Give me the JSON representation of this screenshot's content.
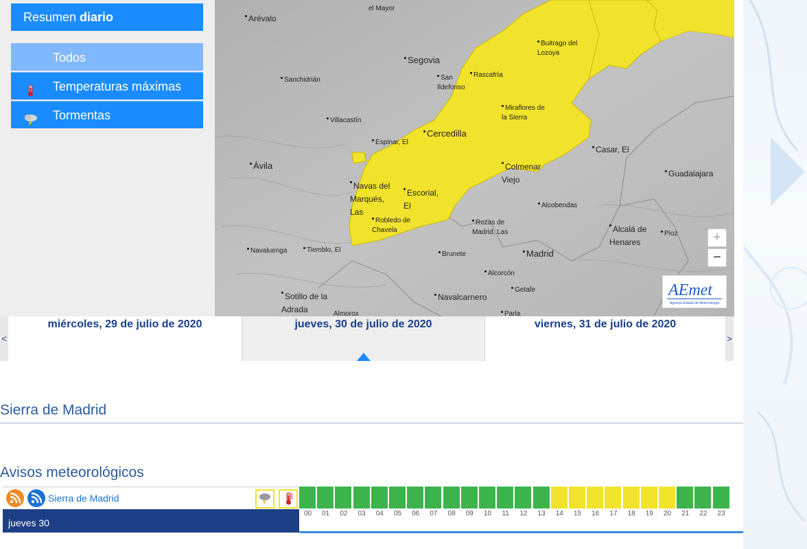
{
  "sidebar": {
    "summary_prefix": "Resumen ",
    "summary_bold": "diario",
    "items": [
      {
        "label": "Todos",
        "icon": "none",
        "active": true
      },
      {
        "label": "Temperaturas máximas",
        "icon": "thermometer-icon",
        "active": false
      },
      {
        "label": "Tormentas",
        "icon": "storm-cloud-icon",
        "active": false
      }
    ]
  },
  "map": {
    "towns": [
      {
        "name": "Arévalo"
      },
      {
        "name": "el Mayor"
      },
      {
        "name": "Segovia"
      },
      {
        "name": "Sanchidrián"
      },
      {
        "name": "San Ildefonso"
      },
      {
        "name": "Rascafría"
      },
      {
        "name": "Buitrago del Lozoya"
      },
      {
        "name": "Villacastín"
      },
      {
        "name": "Miraflores de la Sierra"
      },
      {
        "name": "Espinar, El"
      },
      {
        "name": "Cercedilla"
      },
      {
        "name": "Casar, El"
      },
      {
        "name": "Ávila"
      },
      {
        "name": "Colmenar Viejo"
      },
      {
        "name": "Guadalajara"
      },
      {
        "name": "Navas del Marqués, Las"
      },
      {
        "name": "Escorial, El"
      },
      {
        "name": "Alcobendas"
      },
      {
        "name": "Robledo de Chavela"
      },
      {
        "name": "Rozas de Madrid, Las"
      },
      {
        "name": "Alcalá de Henares"
      },
      {
        "name": "Pioz"
      },
      {
        "name": "Navaluenga"
      },
      {
        "name": "Tiemblo, El"
      },
      {
        "name": "Brunete"
      },
      {
        "name": "Madrid"
      },
      {
        "name": "Alcorcón"
      },
      {
        "name": "Sotillo de la Adrada"
      },
      {
        "name": "Getafe"
      },
      {
        "name": "Navalcarnero"
      },
      {
        "name": "Parla"
      },
      {
        "name": "Almorox"
      }
    ],
    "zoom_in": "+",
    "zoom_out": "−",
    "logo_text": "AEmet",
    "logo_subtext": "Agencia Estatal de Meteorología",
    "colors": {
      "warning_yellow": "#f1e22b",
      "land": "#b9b9b9"
    }
  },
  "dates": {
    "prev_arrow": "<",
    "next_arrow": ">",
    "days": [
      "miércoles, 29 de julio de 2020",
      "jueves, 30 de julio de 2020",
      "viernes, 31 de julio de 2020"
    ],
    "selected_index": 1
  },
  "zone_title": "Sierra de Madrid",
  "avisos": {
    "title": "Avisos meteorológicos",
    "zone_link": "Sierra de Madrid",
    "day_label": "jueves 30",
    "hours": [
      "00",
      "01",
      "02",
      "03",
      "04",
      "05",
      "06",
      "07",
      "08",
      "09",
      "10",
      "11",
      "12",
      "13",
      "14",
      "15",
      "16",
      "17",
      "18",
      "19",
      "20",
      "21",
      "22",
      "23"
    ],
    "levels": [
      "green",
      "green",
      "green",
      "green",
      "green",
      "green",
      "green",
      "green",
      "green",
      "green",
      "green",
      "green",
      "green",
      "green",
      "yellow",
      "yellow",
      "yellow",
      "yellow",
      "yellow",
      "yellow",
      "yellow",
      "green",
      "green",
      "green"
    ],
    "level_colors": {
      "green": "#3cb44b",
      "yellow": "#f1e22b"
    }
  }
}
